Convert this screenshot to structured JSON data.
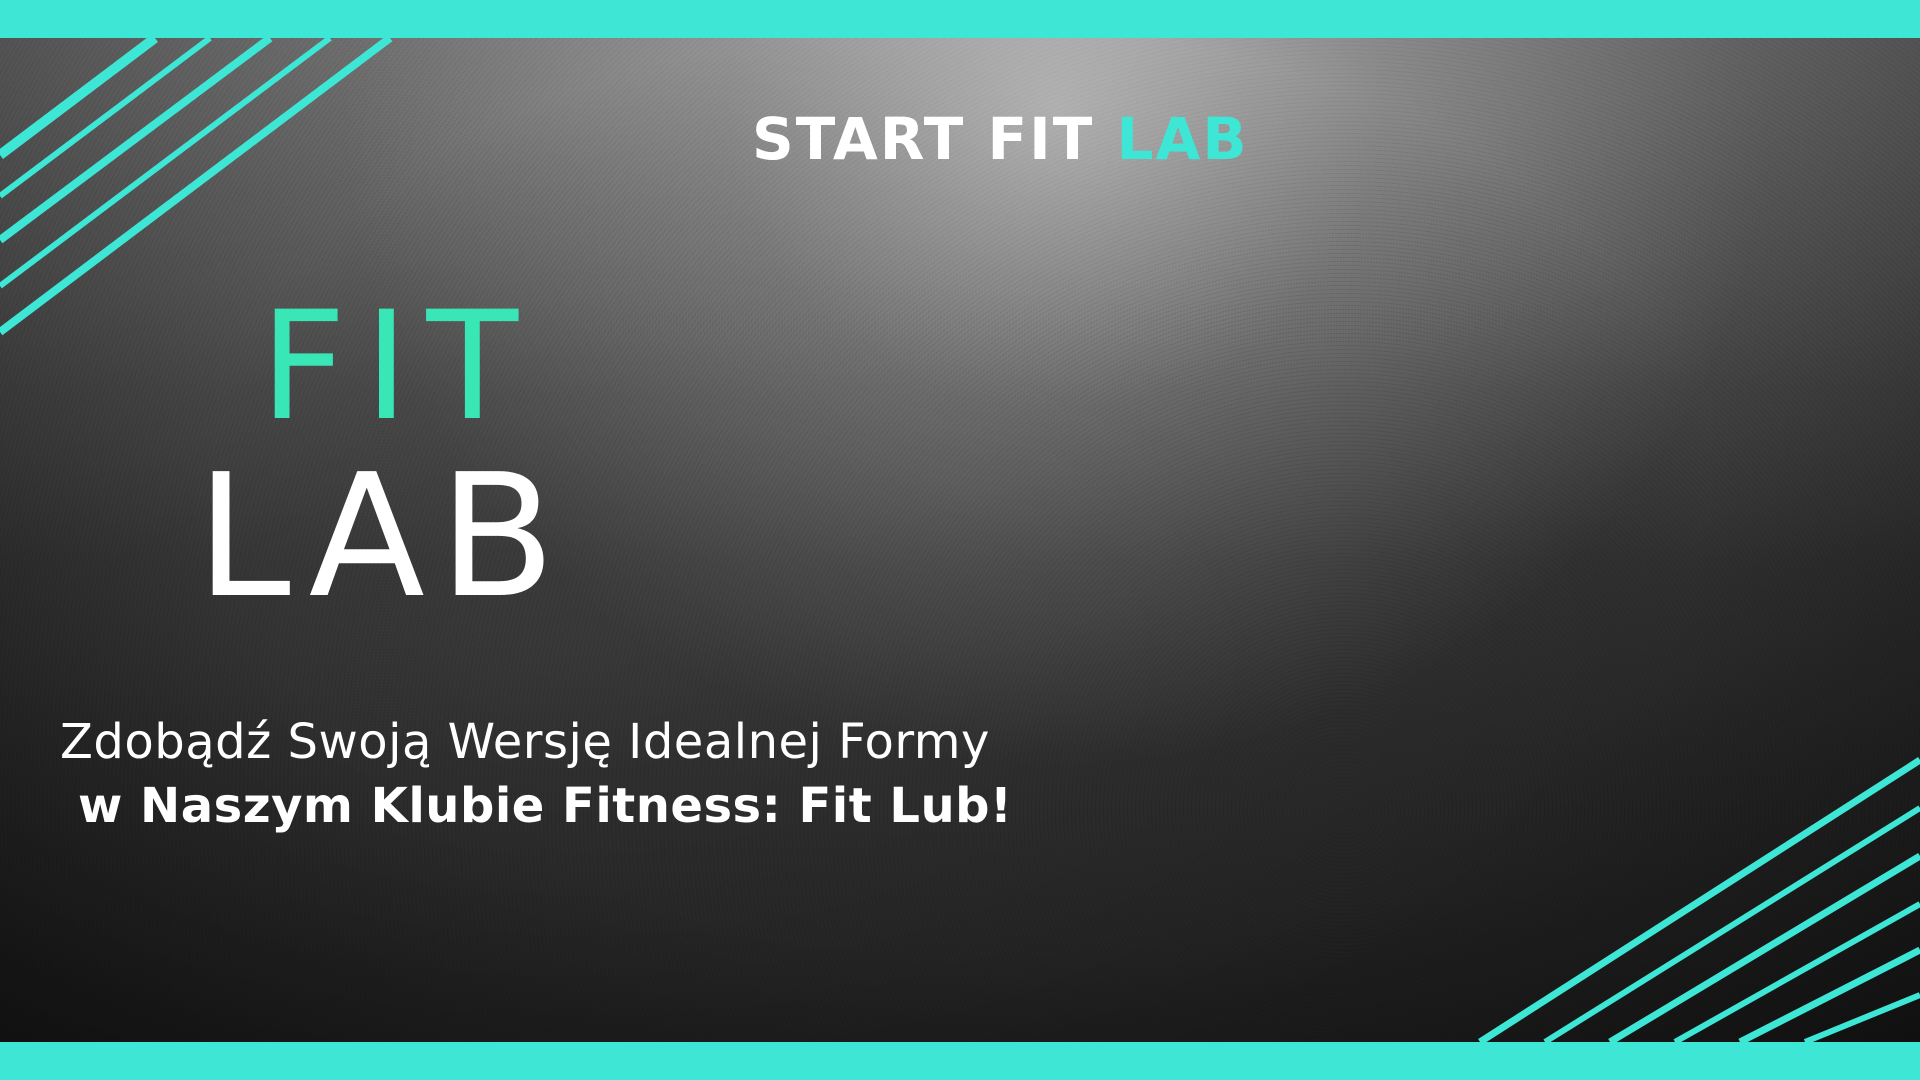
{
  "header": {
    "title_prefix": "START FIT ",
    "title_accent": "LAB"
  },
  "logo": {
    "line1": "FIT",
    "line2": "LAB"
  },
  "headline": {
    "line1": "Zdobądź Swoją Wersję Idealnej Formy",
    "line2": "w Naszym Klubie Fitness: Fit Lub!"
  },
  "colors": {
    "accent_teal": "#3ee6d6",
    "logo_green": "#39e6b6",
    "text_white": "#ffffff"
  }
}
